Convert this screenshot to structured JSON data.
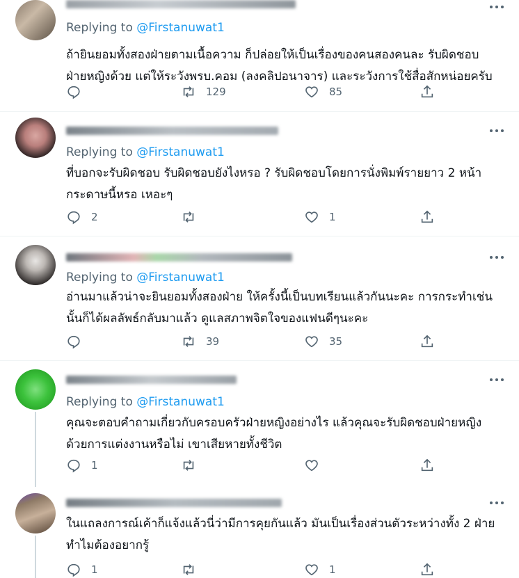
{
  "reply_prefix": "Replying to",
  "tweets": [
    {
      "replying_handle": "@Firstanuwat1",
      "text_lines": [
        "ถ้ายินยอมทั้งสองฝ่ายตามเนื้อความ ก็ปล่อยให้เป็นเรื่องของคนสองคนละ รับผิดชอบ",
        "ฝ่ายหญิงด้วย แต่ให้ระวังพรบ.คอม (ลงคลิปอนาจาร) และระวังการใช้สื่อสักหน่อยครับ"
      ],
      "reply_count": "",
      "retweet_count": "129",
      "like_count": "85"
    },
    {
      "replying_handle": "@Firstanuwat1",
      "text_lines": [
        "ที่บอกจะรับผิดชอบ รับผิดชอบยังไงหรอ ?  รับผิดชอบโดยการนั่งพิมพ์รายยาว 2 หน้า",
        "กระดาษนี้หรอ เหอะๆ"
      ],
      "reply_count": "2",
      "retweet_count": "",
      "like_count": "1"
    },
    {
      "replying_handle": "@Firstanuwat1",
      "text_lines": [
        "อ่านมาแล้วน่าจะยินยอมทั้งสองฝ่าย ให้ครั้งนี้เป็นบทเรียนแล้วกันนะคะ การกระทำเช่น",
        "นั้นก็ได้ผลลัพธ์กลับมาแล้ว ดูแลสภาพจิตใจของแฟนดีๆนะคะ"
      ],
      "reply_count": "",
      "retweet_count": "39",
      "like_count": "35"
    },
    {
      "replying_handle": "@Firstanuwat1",
      "text_lines": [
        "คุณจะตอบคำถามเกี่ยวกับครอบครัวฝ่ายหญิงอย่างไร แล้วคุณจะรับผิดชอบฝ่ายหญิง",
        "ด้วยการแต่งงานหรือไม่ เขาเสียหายทั้งชีวิต"
      ],
      "reply_count": "1",
      "retweet_count": "",
      "like_count": ""
    },
    {
      "replying_handle": "",
      "text_lines": [
        "ในแถลงการณ์เค้าก็แจ้งแล้วนี่ว่ามีการคุยกันแล้ว มันเป็นเรื่องส่วนตัวระหว่างทั้ง 2 ฝ่าย",
        "ทำไมต้องอยากรู้"
      ],
      "reply_count": "1",
      "retweet_count": "",
      "like_count": "1"
    }
  ],
  "colors": {
    "text": "#0f1419",
    "muted": "#536471",
    "accent": "#1d9bf0",
    "divider": "#eff3f4"
  },
  "icons": [
    "reply-icon",
    "retweet-icon",
    "like-icon",
    "share-icon",
    "more-icon"
  ]
}
